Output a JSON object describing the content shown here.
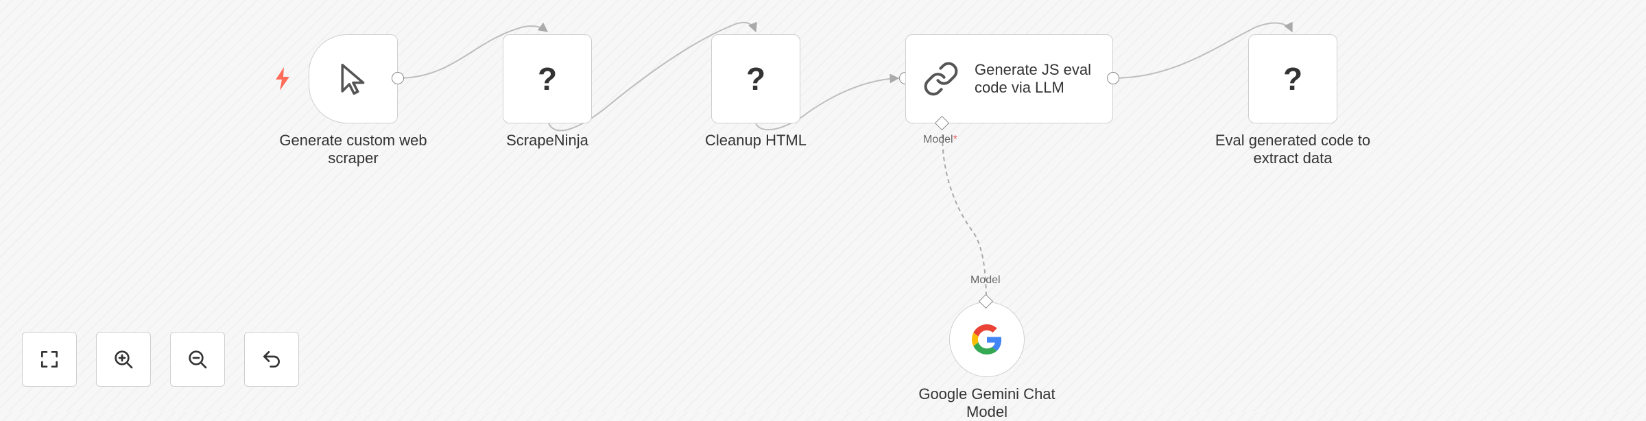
{
  "nodes": {
    "trigger": {
      "label": "Generate custom web scraper",
      "icon": "cursor-click-icon"
    },
    "scrapeninja": {
      "label": "ScrapeNinja",
      "icon": "question-mark-icon",
      "glyph": "?"
    },
    "cleanup": {
      "label": "Cleanup HTML",
      "icon": "question-mark-icon",
      "glyph": "?"
    },
    "llm": {
      "label": "Generate JS eval code via LLM",
      "icon": "link-icon"
    },
    "eval": {
      "label": "Eval generated code to extract data",
      "icon": "question-mark-icon",
      "glyph": "?"
    },
    "gemini": {
      "label": "Google Gemini Chat Model",
      "icon": "google-icon"
    }
  },
  "connectors": {
    "llm_model_label": "Model",
    "llm_model_required": "*",
    "gemini_model_label": "Model"
  },
  "controls": [
    {
      "name": "fit-to-view-button",
      "icon": "fullscreen-icon"
    },
    {
      "name": "zoom-in-button",
      "icon": "zoom-in-icon"
    },
    {
      "name": "zoom-out-button",
      "icon": "zoom-out-icon"
    },
    {
      "name": "reset-zoom-button",
      "icon": "undo-icon"
    }
  ],
  "colors": {
    "trigger_bolt": "#ff6d5a",
    "required_marker": "#e85a5a",
    "edge": "#bdbdbd",
    "google_blue": "#4285F4",
    "google_red": "#EA4335",
    "google_yellow": "#FBBC05",
    "google_green": "#34A853"
  }
}
